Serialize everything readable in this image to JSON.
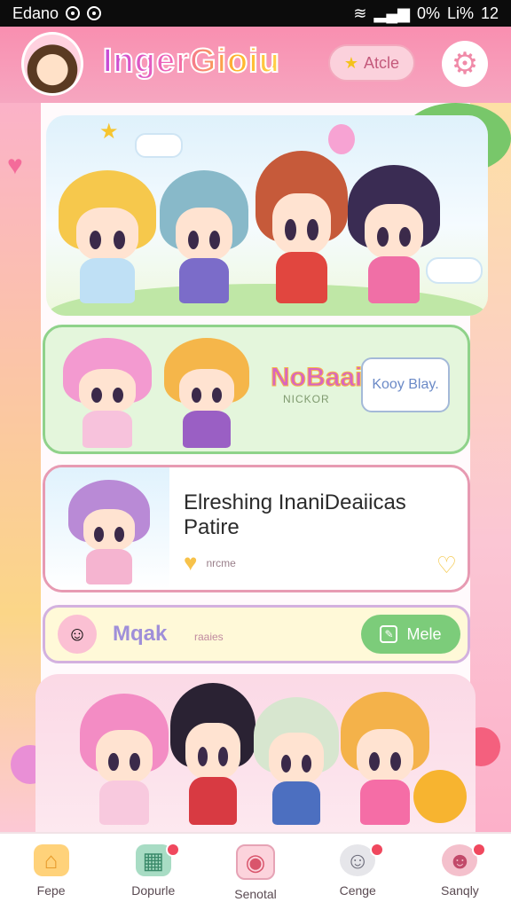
{
  "status": {
    "carrier": "Edano",
    "battery": "0%",
    "signal": "Li%",
    "time": "12"
  },
  "header": {
    "app_title": "IngerGioiu",
    "article_label": "Atcle"
  },
  "hero": {
    "chibis": [
      {
        "hair": "#f6c84c",
        "body": "#bfe0f5"
      },
      {
        "hair": "#88b9c9",
        "body": "#7b6cc9"
      },
      {
        "hair": "#c65a3a",
        "body": "#e1463f"
      },
      {
        "hair": "#3a2c53",
        "body": "#f06fa6"
      }
    ]
  },
  "green_card": {
    "title": "NoBaai",
    "subtitle": "NICKOR",
    "bubble": "Kooy Blay."
  },
  "white_card": {
    "title": "Elreshing InaniDeaiicas Patire",
    "tag": "nrcme"
  },
  "yellow_card": {
    "title": "Mqak",
    "subtitle": "raaies",
    "button": "Mele"
  },
  "nav": {
    "items": [
      {
        "label": "Fepe",
        "icon": "home-icon"
      },
      {
        "label": "Dopurle",
        "icon": "shop-icon"
      },
      {
        "label": "Senotal",
        "icon": "camera-icon"
      },
      {
        "label": "Cenge",
        "icon": "smile-icon"
      },
      {
        "label": "Sanqly",
        "icon": "profile-icon"
      }
    ]
  },
  "colors": {
    "header": "#f98fb0",
    "accent_green": "#7ccc7a",
    "accent_pink": "#e79ab2"
  }
}
